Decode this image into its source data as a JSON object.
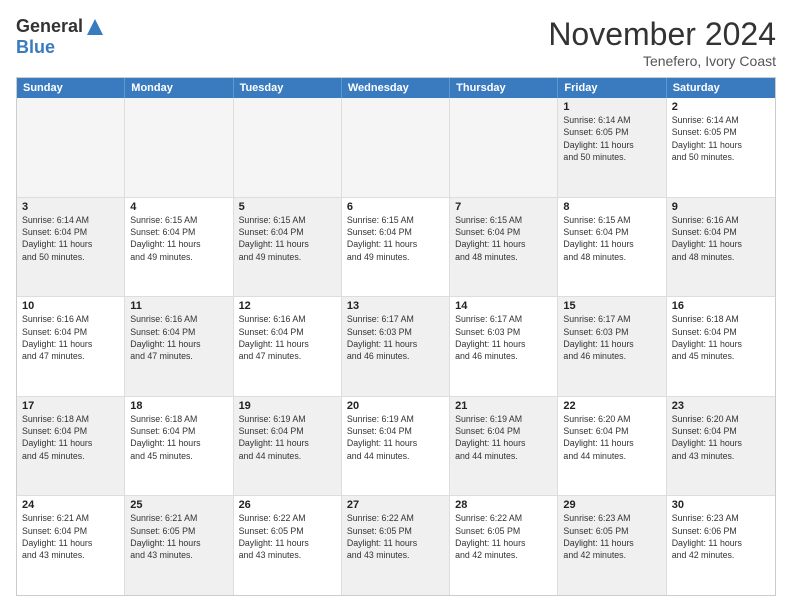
{
  "header": {
    "logo_general": "General",
    "logo_blue": "Blue",
    "month_title": "November 2024",
    "subtitle": "Tenefero, Ivory Coast"
  },
  "calendar": {
    "days_of_week": [
      "Sunday",
      "Monday",
      "Tuesday",
      "Wednesday",
      "Thursday",
      "Friday",
      "Saturday"
    ],
    "rows": [
      {
        "cells": [
          {
            "day": "",
            "info": "",
            "empty": true
          },
          {
            "day": "",
            "info": "",
            "empty": true
          },
          {
            "day": "",
            "info": "",
            "empty": true
          },
          {
            "day": "",
            "info": "",
            "empty": true
          },
          {
            "day": "",
            "info": "",
            "empty": true
          },
          {
            "day": "1",
            "info": "Sunrise: 6:14 AM\nSunset: 6:05 PM\nDaylight: 11 hours\nand 50 minutes.",
            "shaded": true
          },
          {
            "day": "2",
            "info": "Sunrise: 6:14 AM\nSunset: 6:05 PM\nDaylight: 11 hours\nand 50 minutes.",
            "shaded": false
          }
        ]
      },
      {
        "cells": [
          {
            "day": "3",
            "info": "Sunrise: 6:14 AM\nSunset: 6:04 PM\nDaylight: 11 hours\nand 50 minutes.",
            "shaded": true
          },
          {
            "day": "4",
            "info": "Sunrise: 6:15 AM\nSunset: 6:04 PM\nDaylight: 11 hours\nand 49 minutes.",
            "shaded": false
          },
          {
            "day": "5",
            "info": "Sunrise: 6:15 AM\nSunset: 6:04 PM\nDaylight: 11 hours\nand 49 minutes.",
            "shaded": true
          },
          {
            "day": "6",
            "info": "Sunrise: 6:15 AM\nSunset: 6:04 PM\nDaylight: 11 hours\nand 49 minutes.",
            "shaded": false
          },
          {
            "day": "7",
            "info": "Sunrise: 6:15 AM\nSunset: 6:04 PM\nDaylight: 11 hours\nand 48 minutes.",
            "shaded": true
          },
          {
            "day": "8",
            "info": "Sunrise: 6:15 AM\nSunset: 6:04 PM\nDaylight: 11 hours\nand 48 minutes.",
            "shaded": false
          },
          {
            "day": "9",
            "info": "Sunrise: 6:16 AM\nSunset: 6:04 PM\nDaylight: 11 hours\nand 48 minutes.",
            "shaded": true
          }
        ]
      },
      {
        "cells": [
          {
            "day": "10",
            "info": "Sunrise: 6:16 AM\nSunset: 6:04 PM\nDaylight: 11 hours\nand 47 minutes.",
            "shaded": false
          },
          {
            "day": "11",
            "info": "Sunrise: 6:16 AM\nSunset: 6:04 PM\nDaylight: 11 hours\nand 47 minutes.",
            "shaded": true
          },
          {
            "day": "12",
            "info": "Sunrise: 6:16 AM\nSunset: 6:04 PM\nDaylight: 11 hours\nand 47 minutes.",
            "shaded": false
          },
          {
            "day": "13",
            "info": "Sunrise: 6:17 AM\nSunset: 6:03 PM\nDaylight: 11 hours\nand 46 minutes.",
            "shaded": true
          },
          {
            "day": "14",
            "info": "Sunrise: 6:17 AM\nSunset: 6:03 PM\nDaylight: 11 hours\nand 46 minutes.",
            "shaded": false
          },
          {
            "day": "15",
            "info": "Sunrise: 6:17 AM\nSunset: 6:03 PM\nDaylight: 11 hours\nand 46 minutes.",
            "shaded": true
          },
          {
            "day": "16",
            "info": "Sunrise: 6:18 AM\nSunset: 6:04 PM\nDaylight: 11 hours\nand 45 minutes.",
            "shaded": false
          }
        ]
      },
      {
        "cells": [
          {
            "day": "17",
            "info": "Sunrise: 6:18 AM\nSunset: 6:04 PM\nDaylight: 11 hours\nand 45 minutes.",
            "shaded": true
          },
          {
            "day": "18",
            "info": "Sunrise: 6:18 AM\nSunset: 6:04 PM\nDaylight: 11 hours\nand 45 minutes.",
            "shaded": false
          },
          {
            "day": "19",
            "info": "Sunrise: 6:19 AM\nSunset: 6:04 PM\nDaylight: 11 hours\nand 44 minutes.",
            "shaded": true
          },
          {
            "day": "20",
            "info": "Sunrise: 6:19 AM\nSunset: 6:04 PM\nDaylight: 11 hours\nand 44 minutes.",
            "shaded": false
          },
          {
            "day": "21",
            "info": "Sunrise: 6:19 AM\nSunset: 6:04 PM\nDaylight: 11 hours\nand 44 minutes.",
            "shaded": true
          },
          {
            "day": "22",
            "info": "Sunrise: 6:20 AM\nSunset: 6:04 PM\nDaylight: 11 hours\nand 44 minutes.",
            "shaded": false
          },
          {
            "day": "23",
            "info": "Sunrise: 6:20 AM\nSunset: 6:04 PM\nDaylight: 11 hours\nand 43 minutes.",
            "shaded": true
          }
        ]
      },
      {
        "cells": [
          {
            "day": "24",
            "info": "Sunrise: 6:21 AM\nSunset: 6:04 PM\nDaylight: 11 hours\nand 43 minutes.",
            "shaded": false
          },
          {
            "day": "25",
            "info": "Sunrise: 6:21 AM\nSunset: 6:05 PM\nDaylight: 11 hours\nand 43 minutes.",
            "shaded": true
          },
          {
            "day": "26",
            "info": "Sunrise: 6:22 AM\nSunset: 6:05 PM\nDaylight: 11 hours\nand 43 minutes.",
            "shaded": false
          },
          {
            "day": "27",
            "info": "Sunrise: 6:22 AM\nSunset: 6:05 PM\nDaylight: 11 hours\nand 43 minutes.",
            "shaded": true
          },
          {
            "day": "28",
            "info": "Sunrise: 6:22 AM\nSunset: 6:05 PM\nDaylight: 11 hours\nand 42 minutes.",
            "shaded": false
          },
          {
            "day": "29",
            "info": "Sunrise: 6:23 AM\nSunset: 6:05 PM\nDaylight: 11 hours\nand 42 minutes.",
            "shaded": true
          },
          {
            "day": "30",
            "info": "Sunrise: 6:23 AM\nSunset: 6:06 PM\nDaylight: 11 hours\nand 42 minutes.",
            "shaded": false
          }
        ]
      }
    ]
  }
}
